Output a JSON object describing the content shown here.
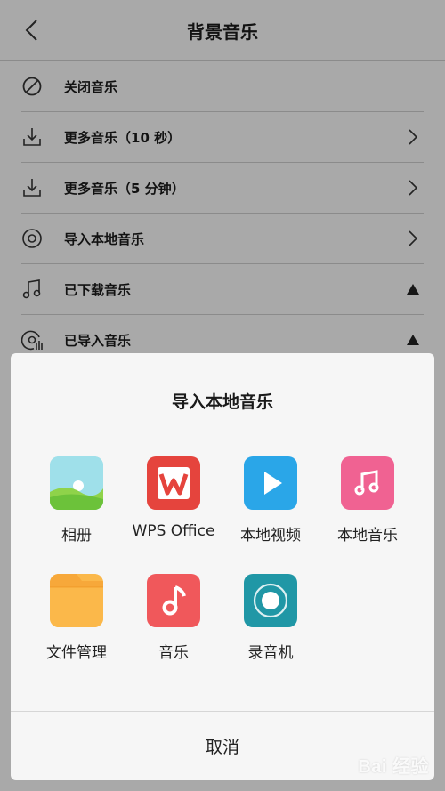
{
  "header": {
    "title": "背景音乐",
    "back_icon": "chevron-left-icon"
  },
  "list": [
    {
      "label": "关闭音乐",
      "icon": "disabled-icon",
      "trail": ""
    },
    {
      "label": "更多音乐（10 秒）",
      "icon": "download-icon",
      "trail": "chevron-right-icon"
    },
    {
      "label": "更多音乐（5 分钟）",
      "icon": "download-icon",
      "trail": "chevron-right-icon"
    },
    {
      "label": "导入本地音乐",
      "icon": "disc-icon",
      "trail": "chevron-right-icon"
    },
    {
      "label": "已下载音乐",
      "icon": "music-note-icon",
      "trail": "triangle-up-icon"
    },
    {
      "label": "已导入音乐",
      "icon": "imported-disc-icon",
      "trail": "triangle-up-icon"
    }
  ],
  "sheet": {
    "title": "导入本地音乐",
    "apps": [
      {
        "label": "相册",
        "icon": "gallery-icon",
        "color": "#8fd8e8"
      },
      {
        "label": "WPS Office",
        "icon": "wps-office-icon",
        "color": "#e5443d"
      },
      {
        "label": "本地视频",
        "icon": "play-icon",
        "color": "#2aa6e8"
      },
      {
        "label": "本地音乐",
        "icon": "music-icon",
        "color": "#f06292"
      },
      {
        "label": "文件管理",
        "icon": "folder-icon",
        "color": "#fbb84a"
      },
      {
        "label": "音乐",
        "icon": "music-note-icon",
        "color": "#f0585b"
      },
      {
        "label": "录音机",
        "icon": "recorder-icon",
        "color": "#2097a6"
      }
    ],
    "cancel_label": "取消"
  },
  "watermark": "Bai 经验"
}
